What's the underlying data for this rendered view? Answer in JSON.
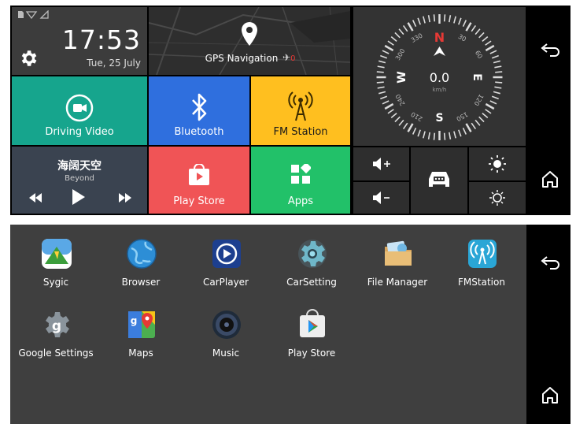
{
  "home": {
    "status_icons": [
      "sd-card-icon",
      "wifi-icon",
      "signal-icon"
    ],
    "clock": {
      "time": "17:53",
      "date": "Tue, 25 July"
    },
    "gps": {
      "label": "GPS Navigation",
      "satellite_count": "0"
    },
    "compass": {
      "speed": "0.0",
      "unit": "km/h",
      "north": "N",
      "south": "S",
      "east": "E",
      "west": "W",
      "degrees": [
        "30",
        "60",
        "120",
        "150",
        "210",
        "240",
        "300",
        "330"
      ]
    },
    "tiles": {
      "driving_video": "Driving Video",
      "bluetooth": "Bluetooth",
      "fm_station": "FM Station",
      "play_store": "Play Store",
      "apps": "Apps"
    },
    "music": {
      "title": "海阔天空",
      "artist": "Beyond"
    }
  },
  "drawer": {
    "apps": [
      {
        "label": "Sygic",
        "icon": "sygic-icon"
      },
      {
        "label": "Browser",
        "icon": "globe-icon"
      },
      {
        "label": "CarPlayer",
        "icon": "video-player-icon"
      },
      {
        "label": "CarSetting",
        "icon": "gear-icon"
      },
      {
        "label": "File Manager",
        "icon": "folder-icon"
      },
      {
        "label": "FMStation",
        "icon": "radio-icon"
      },
      {
        "label": "Google Settings",
        "icon": "google-gear-icon"
      },
      {
        "label": "Maps",
        "icon": "maps-icon"
      },
      {
        "label": "Music",
        "icon": "speaker-icon"
      },
      {
        "label": "Play Store",
        "icon": "play-store-icon"
      }
    ]
  },
  "colors": {
    "driving_video": "#16a58d",
    "bluetooth": "#2f6fde",
    "fm_station": "#ffbf1f",
    "play_store": "#f05456",
    "apps": "#22c169",
    "music": "#3a4350",
    "compass_north": "#e53935"
  }
}
